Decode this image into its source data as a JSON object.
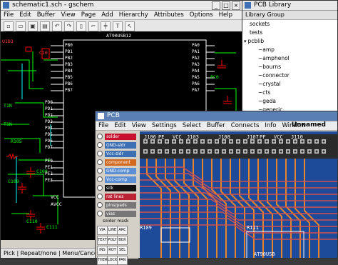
{
  "gschem": {
    "title": "schematic1.sch - gschem",
    "menu": [
      "File",
      "Edit",
      "Buffer",
      "View",
      "Page",
      "Add",
      "Hierarchy",
      "Attributes",
      "Options",
      "Help"
    ],
    "status": "Pick | Repeat/none | Menu/Cancel",
    "labels": {
      "chip": "AT90USB12",
      "ref1": "U1D3",
      "ref2": "C10",
      "ref3": "R105",
      "ref4": "C109",
      "ref5": "C109",
      "ref6": "C110",
      "ref7": "C111",
      "ref8": "T1N",
      "ref9": "T1N",
      "pc0": "PC0",
      "vcc": "VCC",
      "avcc": "AVCC",
      "pe": [
        "PE0",
        "PE1",
        "PE2",
        "PE3"
      ],
      "pd": [
        "PD0",
        "PD1",
        "PD2",
        "PD3",
        "PD4",
        "PD5",
        "PD6",
        "PD7"
      ],
      "pb": [
        "PB0",
        "PB1",
        "PB2",
        "PB3",
        "PB4",
        "PB5",
        "PB6",
        "PB7"
      ],
      "pa": [
        "PA0",
        "PA1",
        "PA2",
        "PA3",
        "PA4",
        "PA5",
        "PA6",
        "PA7"
      ]
    }
  },
  "library": {
    "title": "PCB Library",
    "header": "Library Group",
    "items": [
      "sockets",
      "tests",
      "pcblib",
      "~amp",
      "~amphenol",
      "~bourns",
      "~connector",
      "~crystal",
      "~cts",
      "~geda",
      "~generic"
    ]
  },
  "pcb": {
    "title": "PCB",
    "menu": [
      "File",
      "Edit",
      "View",
      "Settings",
      "Select",
      "Buffer",
      "Connects",
      "Info",
      "Window"
    ],
    "file_name": "Unnamed",
    "layers": [
      {
        "name": "solder",
        "color": "#c8102e"
      },
      {
        "name": "GND-sldr",
        "color": "#3c6fb4"
      },
      {
        "name": "Vcc-sldr",
        "color": "#3c6fb4"
      },
      {
        "name": "component",
        "color": "#d2691e"
      },
      {
        "name": "GND-comp",
        "color": "#5b8fd6"
      },
      {
        "name": "Vcc-comp",
        "color": "#5b8fd6"
      },
      {
        "name": "silk",
        "color": "#111111"
      },
      {
        "name": "rat lines",
        "color": "#bb2233"
      },
      {
        "name": "pins/pads",
        "color": "#777777"
      },
      {
        "name": "vias",
        "color": "#777777"
      }
    ],
    "solder_mask_label": "solder mask",
    "tools": [
      "VIA",
      "LINE",
      "ARC",
      "TEXT",
      "POLY",
      "BOX",
      "INS",
      "ROT",
      "SEL",
      "THERM",
      "LOCK",
      "PAN"
    ],
    "board_labels": [
      "J106",
      "PE",
      "VCC",
      "J103",
      "J108",
      "J107",
      "PF",
      "VCC",
      "J110",
      "R109",
      "R111",
      "AT90USB"
    ]
  },
  "colors": {
    "gschem_bg": "#000000",
    "wire": "#00ff00",
    "net": "#00ffff",
    "pin": "#ffffff",
    "component": "#ff0000",
    "pcb_board": "#1e4a9a",
    "pcb_trace": "#e8842a",
    "pcb_trace2": "#d05050"
  }
}
